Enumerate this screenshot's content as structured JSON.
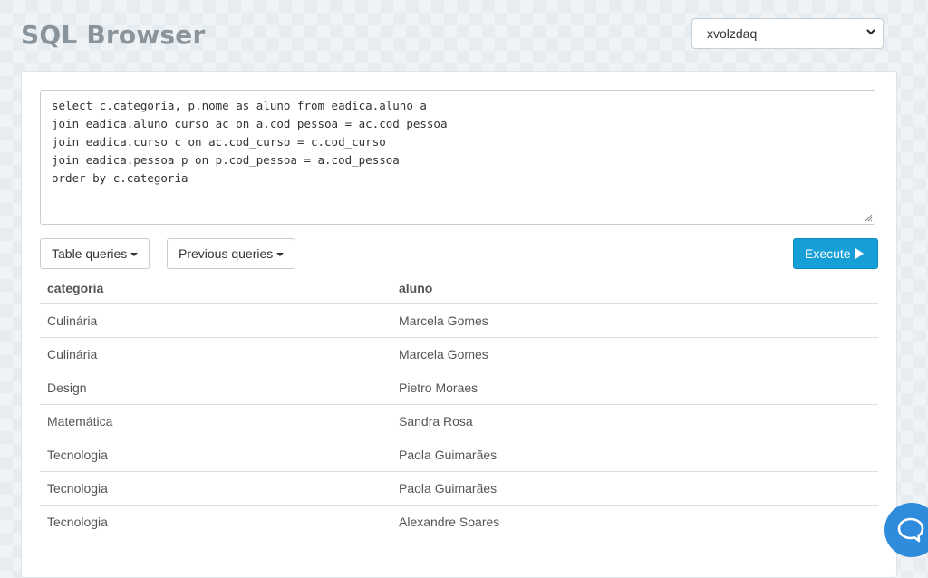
{
  "header": {
    "title": "SQL Browser",
    "database": {
      "selected": "xvolzdaq"
    }
  },
  "editor": {
    "lines": [
      "select c.categoria, p.nome as aluno from eadica.aluno a",
      "join eadica.aluno_curso ac on a.cod_pessoa = ac.cod_pessoa",
      "join eadica.curso c on ac.cod_curso = c.cod_curso",
      "join eadica.pessoa p on p.cod_pessoa = a.cod_pessoa",
      "order by c.categoria"
    ]
  },
  "toolbar": {
    "table_queries_label": "Table queries",
    "previous_queries_label": "Previous queries",
    "execute_label": "Execute"
  },
  "results": {
    "columns": [
      "categoria",
      "aluno"
    ],
    "rows": [
      [
        "Culinária",
        "Marcela Gomes"
      ],
      [
        "Culinária",
        "Marcela Gomes"
      ],
      [
        "Design",
        "Pietro Moraes"
      ],
      [
        "Matemática",
        "Sandra Rosa"
      ],
      [
        "Tecnologia",
        "Paola Guimarães"
      ],
      [
        "Tecnologia",
        "Paola Guimarães"
      ],
      [
        "Tecnologia",
        "Alexandre Soares"
      ]
    ]
  },
  "colors": {
    "accent": "#159fd6",
    "chat_button": "#2f8cdc",
    "title": "#8a949c"
  },
  "icons": {
    "select_arrow": "chevron-down-icon",
    "execute": "play-icon",
    "chat": "chat-bubble-icon"
  }
}
